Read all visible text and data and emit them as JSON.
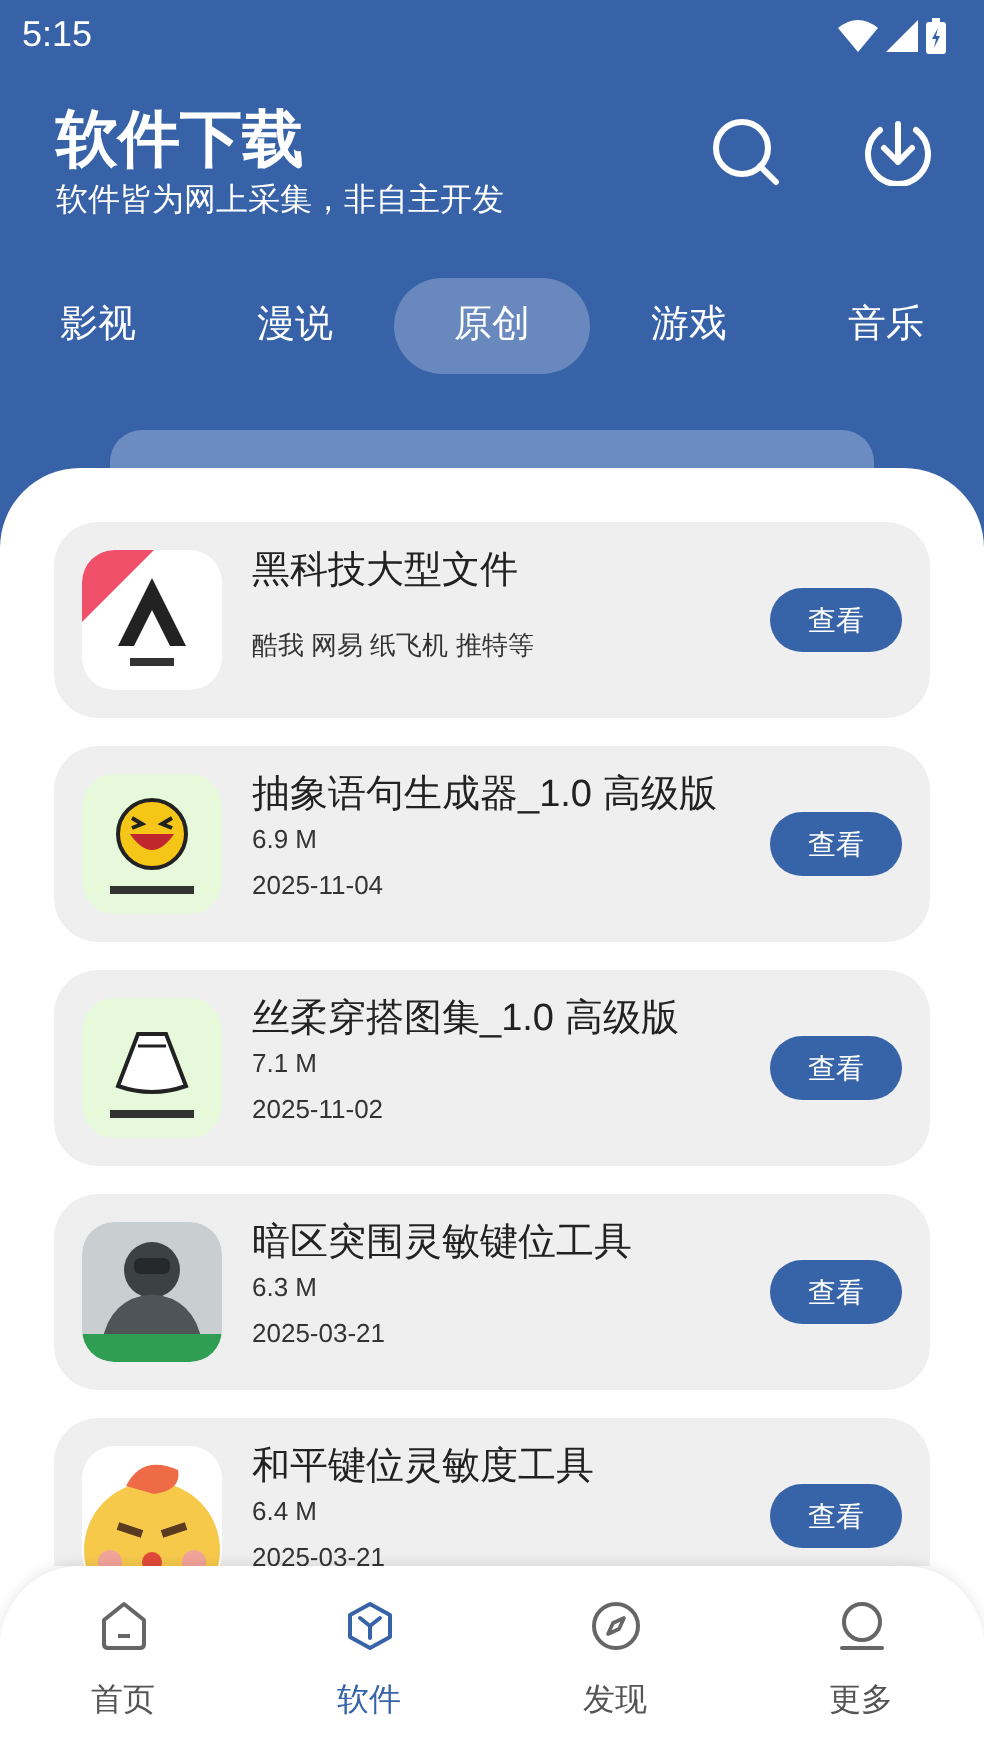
{
  "status_bar": {
    "time": "5:15"
  },
  "header": {
    "title": "软件下载",
    "subtitle": "软件皆为网上采集，非自主开发"
  },
  "tabs": [
    {
      "label": "影视",
      "selected": false
    },
    {
      "label": "漫说",
      "selected": false
    },
    {
      "label": "原创",
      "selected": true
    },
    {
      "label": "游戏",
      "selected": false
    },
    {
      "label": "音乐",
      "selected": false
    }
  ],
  "apps": [
    {
      "name": "黑科技大型文件",
      "description": "酷我 网易 纸飞机 推特等",
      "button": "查看"
    },
    {
      "name": "抽象语句生成器_1.0 高级版",
      "size": "6.9 M",
      "date": "2025-11-04",
      "button": "查看"
    },
    {
      "name": "丝柔穿搭图集_1.0 高级版",
      "size": "7.1 M",
      "date": "2025-11-02",
      "button": "查看"
    },
    {
      "name": "暗区突围灵敏键位工具",
      "size": "6.3 M",
      "date": "2025-03-21",
      "button": "查看"
    },
    {
      "name": "和平键位灵敏度工具",
      "size": "6.4 M",
      "date": "2025-03-21",
      "button": "查看"
    }
  ],
  "bottom_nav": [
    {
      "label": "首页",
      "selected": false
    },
    {
      "label": "软件",
      "selected": true
    },
    {
      "label": "发现",
      "selected": false
    },
    {
      "label": "更多",
      "selected": false
    }
  ]
}
